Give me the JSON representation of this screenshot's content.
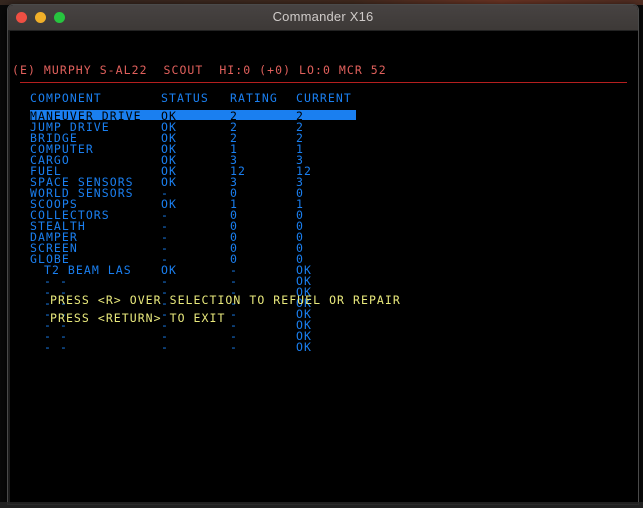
{
  "desktop": {
    "menubar_label": "menu-bar-strip",
    "taskbar_label": "taskbar-strip"
  },
  "window": {
    "title": "Commander X16",
    "controls": {
      "close": "close-button",
      "minimize": "minimize-button",
      "maximize": "maximize-button"
    }
  },
  "screen": {
    "status_line": "(E) MURPHY S-AL22  SCOUT  HI:0 (+0) LO:0 MCR 52",
    "table": {
      "headers": {
        "component": "COMPONENT",
        "status": "STATUS",
        "rating": "RATING",
        "current": "CURRENT"
      },
      "header_rules": {
        "component": "______________",
        "status": "______",
        "rating": "______",
        "current": "_______"
      },
      "rows": [
        {
          "component": "MANEUVER DRIVE",
          "status": "OK",
          "rating": "2",
          "current": "2",
          "selected": true,
          "indent": false
        },
        {
          "component": "JUMP DRIVE",
          "status": "OK",
          "rating": "2",
          "current": "2",
          "selected": false,
          "indent": false
        },
        {
          "component": "BRIDGE",
          "status": "OK",
          "rating": "2",
          "current": "2",
          "selected": false,
          "indent": false
        },
        {
          "component": "COMPUTER",
          "status": "OK",
          "rating": "1",
          "current": "1",
          "selected": false,
          "indent": false
        },
        {
          "component": "CARGO",
          "status": "OK",
          "rating": "3",
          "current": "3",
          "selected": false,
          "indent": false
        },
        {
          "component": "FUEL",
          "status": "OK",
          "rating": "12",
          "current": "12",
          "selected": false,
          "indent": false
        },
        {
          "component": "SPACE SENSORS",
          "status": "OK",
          "rating": "3",
          "current": "3",
          "selected": false,
          "indent": false
        },
        {
          "component": "WORLD SENSORS",
          "status": "-",
          "rating": "0",
          "current": "0",
          "selected": false,
          "indent": false
        },
        {
          "component": "SCOOPS",
          "status": "OK",
          "rating": "1",
          "current": "1",
          "selected": false,
          "indent": false
        },
        {
          "component": "COLLECTORS",
          "status": "-",
          "rating": "0",
          "current": "0",
          "selected": false,
          "indent": false
        },
        {
          "component": "STEALTH",
          "status": "-",
          "rating": "0",
          "current": "0",
          "selected": false,
          "indent": false
        },
        {
          "component": "DAMPER",
          "status": "-",
          "rating": "0",
          "current": "0",
          "selected": false,
          "indent": false
        },
        {
          "component": "SCREEN",
          "status": "-",
          "rating": "0",
          "current": "0",
          "selected": false,
          "indent": false
        },
        {
          "component": "GLOBE",
          "status": "-",
          "rating": "0",
          "current": "0",
          "selected": false,
          "indent": false
        },
        {
          "component": "T2 BEAM LAS",
          "status": "OK",
          "rating": "-",
          "current": "OK",
          "selected": false,
          "indent": true
        },
        {
          "component": "- -",
          "status": "-",
          "rating": "-",
          "current": "OK",
          "selected": false,
          "indent": true
        },
        {
          "component": "- -",
          "status": "-",
          "rating": "-",
          "current": "OK",
          "selected": false,
          "indent": true
        },
        {
          "component": "- -",
          "status": "-",
          "rating": "-",
          "current": "OK",
          "selected": false,
          "indent": true
        },
        {
          "component": "- -",
          "status": "-",
          "rating": "-",
          "current": "OK",
          "selected": false,
          "indent": true
        },
        {
          "component": "- -",
          "status": "-",
          "rating": "-",
          "current": "OK",
          "selected": false,
          "indent": true
        },
        {
          "component": "- -",
          "status": "-",
          "rating": "-",
          "current": "OK",
          "selected": false,
          "indent": true
        },
        {
          "component": "- -",
          "status": "-",
          "rating": "-",
          "current": "OK",
          "selected": false,
          "indent": true
        }
      ]
    },
    "hints": [
      "PRESS <R> OVER SELECTION TO REFUEL OR REPAIR",
      "PRESS <RETURN> TO EXIT"
    ]
  },
  "colors": {
    "terminal_bg": "#000000",
    "text_blue": "#1a7ff0",
    "text_red": "#e0605c",
    "text_yellow": "#e9e97c",
    "rule_red": "#b51f1f",
    "highlight_bg": "#1a7ff0",
    "highlight_fg": "#000000",
    "titlebar_bg": "#423e3d"
  }
}
